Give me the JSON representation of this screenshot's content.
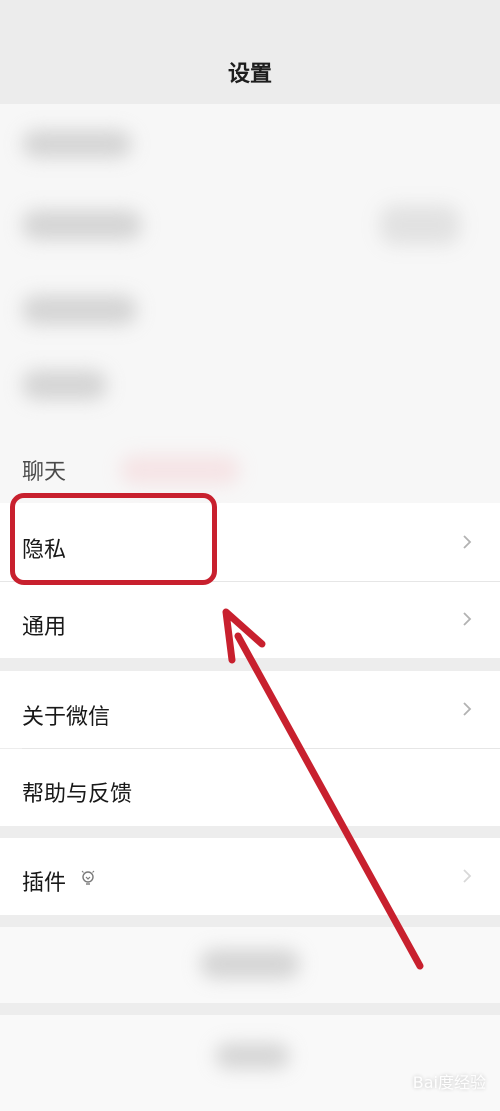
{
  "header": {
    "title": "设置"
  },
  "chat_section": {
    "label": "聊天"
  },
  "menu": {
    "privacy": "隐私",
    "general": "通用",
    "about": "关于微信",
    "help": "帮助与反馈",
    "plugins": "插件"
  },
  "icons": {
    "chevron": "chevron-right-icon",
    "plugin_badge": "lightbulb-icon"
  },
  "colors": {
    "annotation_red": "#c8202e",
    "chevron_gray": "#b2b2b2"
  },
  "watermark": "Bai度经验"
}
